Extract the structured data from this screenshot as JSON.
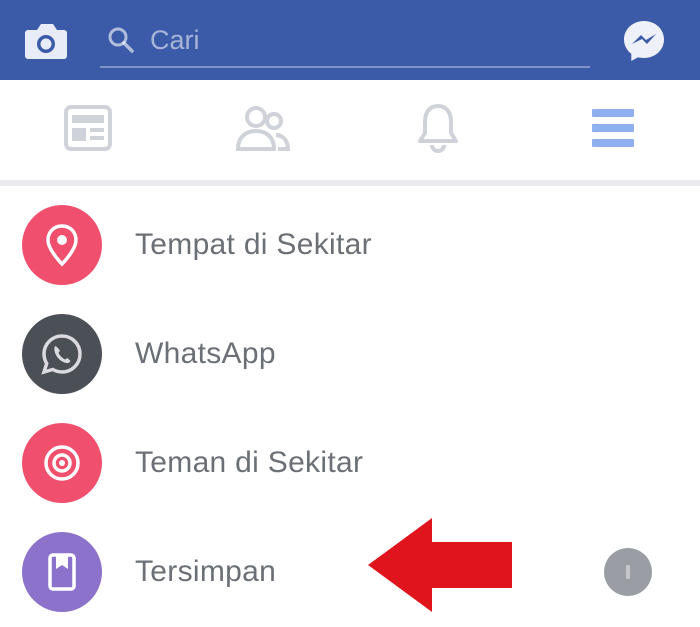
{
  "search": {
    "placeholder": "Cari"
  },
  "header": {
    "buttons": {
      "camera": "camera-icon",
      "messenger": "messenger-icon"
    }
  },
  "tabs": [
    {
      "icon": "news-feed-icon",
      "active": false
    },
    {
      "icon": "friends-icon",
      "active": false
    },
    {
      "icon": "bell-icon",
      "active": false
    },
    {
      "icon": "menu-icon",
      "active": true
    }
  ],
  "menu": {
    "items": [
      {
        "label": "Tempat di Sekitar",
        "icon": "location-pin-icon",
        "color": "#f0506e"
      },
      {
        "label": "WhatsApp",
        "icon": "whatsapp-icon",
        "color": "#4b4f56"
      },
      {
        "label": "Teman di Sekitar",
        "icon": "nearby-friends-icon",
        "color": "#f0506e"
      },
      {
        "label": "Tersimpan",
        "icon": "saved-bookmark-icon",
        "color": "#8c72cb"
      }
    ]
  },
  "annotation": {
    "arrow_icon": "red-arrow-icon",
    "arrow_color": "#e0141c"
  },
  "colors": {
    "brand": "#3b5aa8",
    "active_tab": "#5b86e5",
    "inactive_tab": "#d3d6db"
  }
}
